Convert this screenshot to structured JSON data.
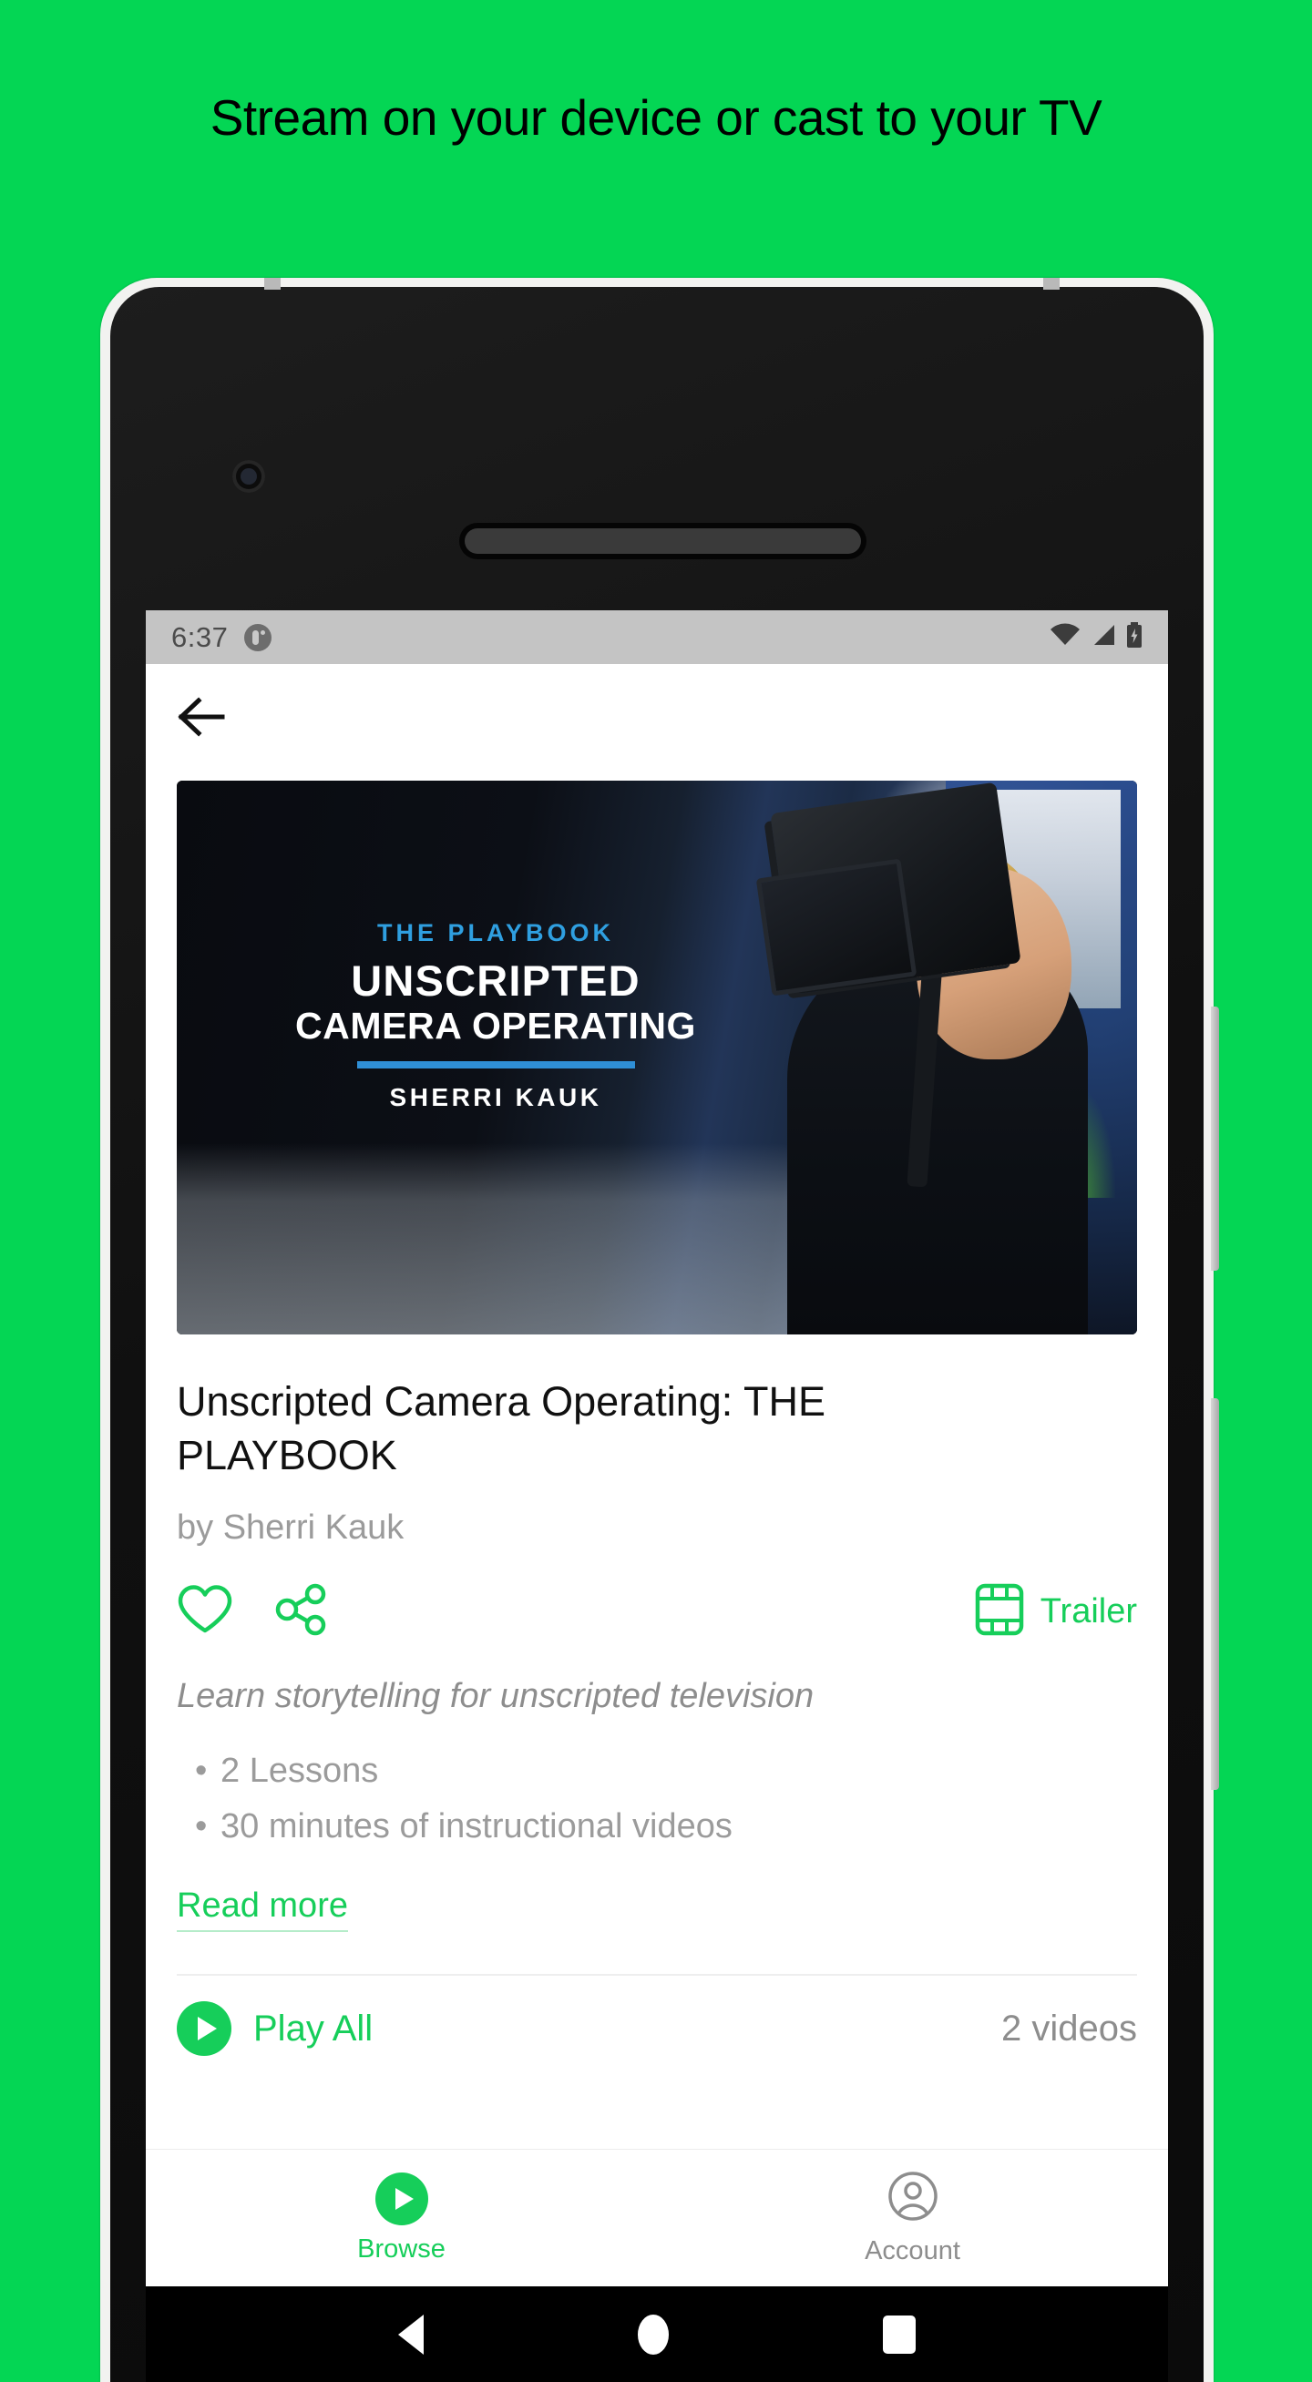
{
  "promo": {
    "headline": "Stream on your device or cast to your TV",
    "background_color": "#04d654"
  },
  "theme": {
    "accent_green": "#16ce5a",
    "muted_gray": "#9b9b9b",
    "brand_blue": "#2f9fe0"
  },
  "status_bar": {
    "time": "6:37",
    "app_icon": "app-notification-icon",
    "wifi_icon": "wifi-icon",
    "signal_icon": "cellular-signal-icon",
    "battery_icon": "battery-charging-icon"
  },
  "app_bar": {
    "back_icon": "arrow-left-icon"
  },
  "hero": {
    "kicker": "THE PLAYBOOK",
    "title_line_1": "UNSCRIPTED",
    "title_line_2": "CAMERA OPERATING",
    "author": "SHERRI KAUK"
  },
  "course": {
    "title": "Unscripted Camera Operating: THE PLAYBOOK",
    "byline": "by Sherri Kauk",
    "blurb": "Learn storytelling for unscripted television",
    "bullets": [
      "2 Lessons",
      "30 minutes of instructional videos"
    ],
    "read_more_label": "Read more"
  },
  "actions": {
    "favorite_icon": "heart-outline-icon",
    "share_icon": "share-nodes-icon",
    "trailer_icon": "film-strip-icon",
    "trailer_label": "Trailer"
  },
  "play_all": {
    "icon": "play-circle-icon",
    "label": "Play All",
    "count_label": "2 videos"
  },
  "tab_bar": {
    "tabs": [
      {
        "label": "Browse",
        "icon": "play-circle-icon",
        "active": true
      },
      {
        "label": "Account",
        "icon": "account-circle-icon",
        "active": false
      }
    ]
  },
  "android_nav": {
    "back_icon": "nav-back-triangle-icon",
    "home_icon": "nav-home-circle-icon",
    "recents_icon": "nav-recents-square-icon"
  }
}
